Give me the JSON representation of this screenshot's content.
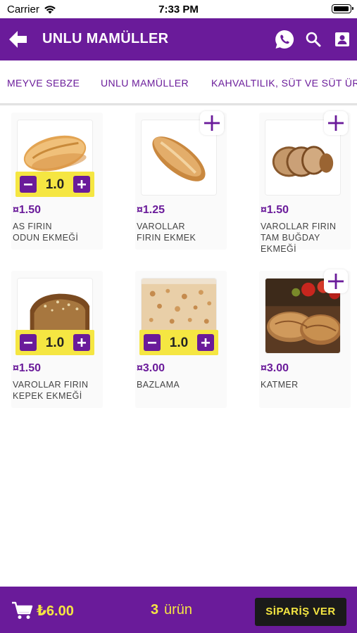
{
  "status_bar": {
    "carrier": "Carrier",
    "time": "7:33 PM"
  },
  "header": {
    "title": "UNLU MAMÜLLER",
    "icons": [
      "back-arrow-icon",
      "whatsapp-icon",
      "search-icon",
      "contact-card-icon"
    ]
  },
  "categories": [
    {
      "label": "MEYVE SEBZE"
    },
    {
      "label": "UNLU MAMÜLLER"
    },
    {
      "label": "KAHVALTILIK, SÜT VE SÜT ÜR"
    }
  ],
  "products": [
    {
      "price": "¤1.50",
      "name_line1": "AS FIRIN",
      "name_line2": "ODUN EKMEĞİ",
      "name_line3": "",
      "quantity": "1.0",
      "in_cart": true
    },
    {
      "price": "¤1.25",
      "name_line1": "VAROLLAR",
      "name_line2": "FIRIN EKMEK",
      "name_line3": "",
      "quantity": "",
      "in_cart": false
    },
    {
      "price": "¤1.50",
      "name_line1": "VAROLLAR FIRIN",
      "name_line2": "TAM BUĞDAY",
      "name_line3": "EKMEĞİ",
      "quantity": "",
      "in_cart": false
    },
    {
      "price": "¤1.50",
      "name_line1": "VAROLLAR FIRIN",
      "name_line2": "KEPEK EKMEĞİ",
      "name_line3": "",
      "quantity": "1.0",
      "in_cart": true
    },
    {
      "price": "¤3.00",
      "name_line1": "BAZLAMA",
      "name_line2": "",
      "name_line3": "",
      "quantity": "1.0",
      "in_cart": true
    },
    {
      "price": "¤3.00",
      "name_line1": "KATMER",
      "name_line2": "",
      "name_line3": "",
      "quantity": "",
      "in_cart": false
    }
  ],
  "bottom_bar": {
    "total": "₺6.00",
    "item_count": "3",
    "item_word": "ürün",
    "order_label": "SİPARİŞ VER"
  },
  "colors": {
    "primary": "#6a1b9a",
    "accent": "#f5e642",
    "button_dark": "#1a1a1a"
  }
}
